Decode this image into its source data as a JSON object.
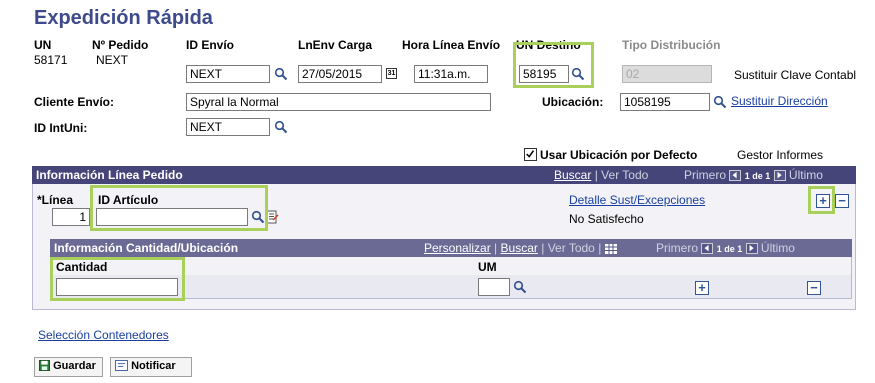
{
  "page": {
    "title": "Expedición Rápida"
  },
  "header": {
    "un_label": "UN",
    "un_value": "58171",
    "pedido_label": "Nº Pedido",
    "pedido_value": "NEXT",
    "id_envio_label": "ID Envío",
    "id_envio_value": "NEXT",
    "lnenv_label": "LnEnv Carga",
    "lnenv_value": "27/05/2015",
    "hora_label": "Hora Línea Envío",
    "hora_value": "11:31a.m.",
    "un_destino_label": "UN Destino",
    "un_destino_value": "58195",
    "tipo_dist_label": "Tipo Distribución",
    "tipo_dist_value": "02",
    "sustituir_clave_label": "Sustituir Clave Contabl",
    "cliente_label": "Cliente Envío:",
    "cliente_value": "Spyral la Normal",
    "ubicacion_label": "Ubicación:",
    "ubicacion_value": "1058195",
    "sustituir_direccion_link": "Sustituir Dirección",
    "idintuni_label": "ID IntUni:",
    "idintuni_value": "NEXT",
    "usar_ubicacion_label": "Usar Ubicación por Defecto",
    "gestor_informes_label": "Gestor Informes"
  },
  "linea_section": {
    "title": "Información Línea Pedido",
    "buscar_link": "Buscar",
    "ver_todo": "Ver Todo",
    "primero": "Primero",
    "page_indicator": "1 de 1",
    "ultimo": "Último",
    "linea_label": "*Línea",
    "linea_value": "1",
    "id_articulo_label": "ID Artículo",
    "id_articulo_value": "",
    "detalle_link": "Detalle Sust/Excepciones",
    "no_satisfecho": "No Satisfecho",
    "separator": "|"
  },
  "cantidad_section": {
    "title": "Información Cantidad/Ubicación",
    "personalizar_link": "Personalizar",
    "buscar_link": "Buscar",
    "ver_todo": "Ver Todo",
    "primero": "Primero",
    "page_indicator": "1 de 1",
    "ultimo": "Último",
    "cantidad_label": "Cantidad",
    "cantidad_value": "",
    "um_label": "UM",
    "um_value": "",
    "separator": "|"
  },
  "footer": {
    "seleccion_link": "Selección Contenedores",
    "guardar_label": "Guardar",
    "notificar_label": "Notificar"
  },
  "colors": {
    "title": "#3d4a8c",
    "section_header": "#45457a",
    "sub_header": "#6a6a95",
    "highlight": "#a9d05a",
    "link": "#1a3fa0"
  }
}
